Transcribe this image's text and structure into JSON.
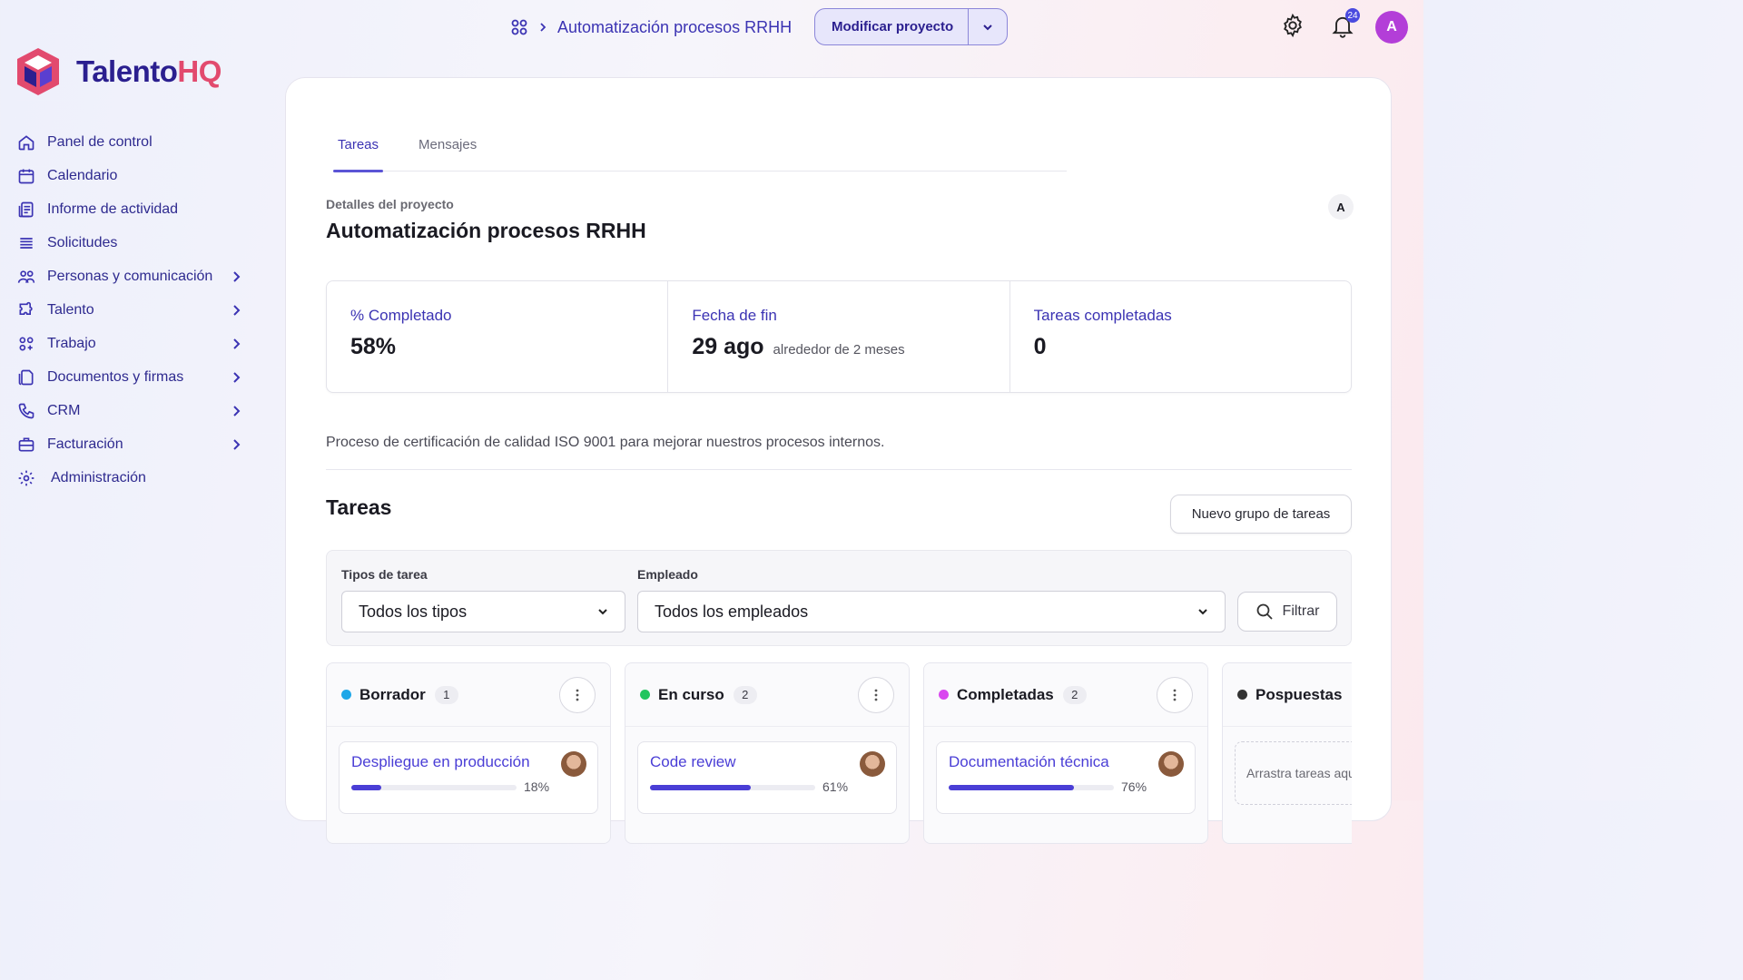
{
  "brand": {
    "name_part1": "Talento",
    "name_part2": "HQ",
    "accent": "#2b1f8f",
    "accent2": "#e24a6e"
  },
  "sidebar": {
    "items": [
      {
        "label": "Panel de control",
        "icon": "home-icon",
        "expandable": false
      },
      {
        "label": "Calendario",
        "icon": "calendar-icon",
        "expandable": false
      },
      {
        "label": "Informe de actividad",
        "icon": "report-icon",
        "expandable": false
      },
      {
        "label": "Solicitudes",
        "icon": "list-icon",
        "expandable": false
      },
      {
        "label": "Personas y comunicación",
        "icon": "people-icon",
        "expandable": true
      },
      {
        "label": "Talento",
        "icon": "puzzle-icon",
        "expandable": true
      },
      {
        "label": "Trabajo",
        "icon": "apps-icon",
        "expandable": true
      },
      {
        "label": "Documentos y firmas",
        "icon": "documents-icon",
        "expandable": true
      },
      {
        "label": "CRM",
        "icon": "phone-icon",
        "expandable": true
      },
      {
        "label": "Facturación",
        "icon": "briefcase-icon",
        "expandable": true
      },
      {
        "label": "Administración",
        "icon": "gear-icon",
        "expandable": false
      }
    ]
  },
  "header": {
    "breadcrumb_current": "Automatización procesos RRHH",
    "modify_label": "Modificar proyecto",
    "notifications_count": "24",
    "user_initial": "A"
  },
  "tabs": [
    {
      "label": "Tareas",
      "active": true
    },
    {
      "label": "Mensajes",
      "active": false
    }
  ],
  "project": {
    "subtitle": "Detalles del proyecto",
    "title": "Automatización procesos RRHH",
    "owner_initial": "A",
    "description": "Proceso de certificación de calidad ISO 9001 para mejorar nuestros procesos internos."
  },
  "stats": [
    {
      "label": "% Completado",
      "value": "58%",
      "note": ""
    },
    {
      "label": "Fecha de fin",
      "value": "29 ago",
      "note": "alrededor de 2 meses"
    },
    {
      "label": "Tareas completadas",
      "value": "0",
      "note": ""
    }
  ],
  "tasks": {
    "title": "Tareas",
    "new_group_label": "Nuevo grupo de tareas",
    "filters": {
      "type_label": "Tipos de tarea",
      "type_value": "Todos los tipos",
      "employee_label": "Empleado",
      "employee_value": "Todos los empleados",
      "filter_label": "Filtrar"
    },
    "columns": [
      {
        "name": "Borrador",
        "count": "1",
        "color": "#1ea7e8",
        "card": {
          "title": "Despliegue en producción",
          "progress": 18,
          "pct": "18%"
        }
      },
      {
        "name": "En curso",
        "count": "2",
        "color": "#22c55e",
        "card": {
          "title": "Code review",
          "progress": 61,
          "pct": "61%"
        }
      },
      {
        "name": "Completadas",
        "count": "2",
        "color": "#d946ef",
        "card": {
          "title": "Documentación técnica",
          "progress": 76,
          "pct": "76%"
        }
      },
      {
        "name": "Pospuestas",
        "count": "",
        "color": "#333333",
        "dropzone": "Arrastra tareas aquí"
      }
    ]
  }
}
